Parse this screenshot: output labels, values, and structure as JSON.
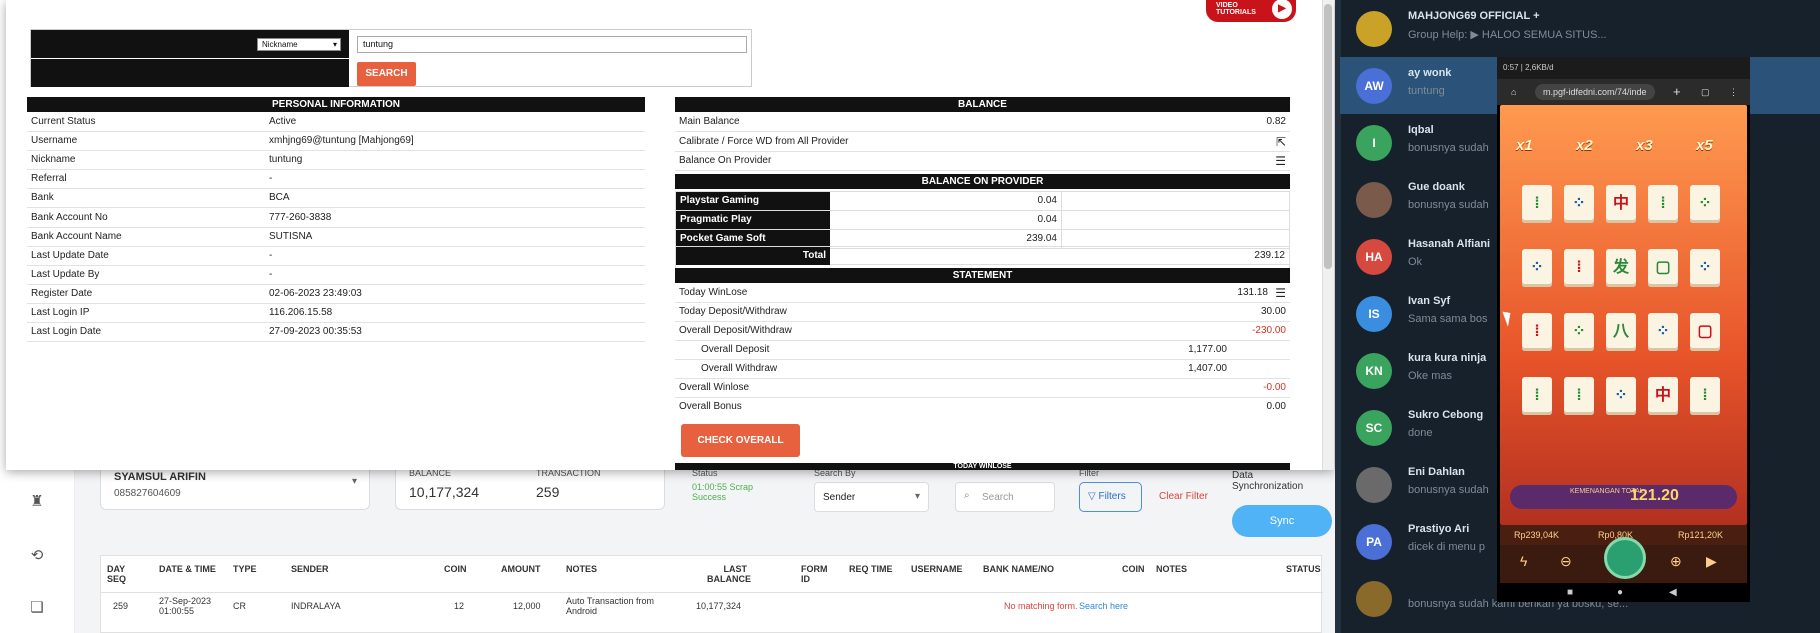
{
  "modal": {
    "search": {
      "select_value": "Nickname",
      "input_value": "tuntung",
      "button": "SEARCH"
    },
    "personal": {
      "title": "PERSONAL INFORMATION",
      "rows": [
        {
          "label": "Current Status",
          "value": "Active"
        },
        {
          "label": "Username",
          "value": "xmhjng69@tuntung  [Mahjong69]"
        },
        {
          "label": "Nickname",
          "value": "tuntung"
        },
        {
          "label": "Referral",
          "value": "-"
        },
        {
          "label": "Bank",
          "value": "BCA"
        },
        {
          "label": "Bank Account No",
          "value": "777-260-3838"
        },
        {
          "label": "Bank Account Name",
          "value": "SUTISNA"
        },
        {
          "label": "Last Update Date",
          "value": "-"
        },
        {
          "label": "Last Update By",
          "value": "-"
        },
        {
          "label": "Register Date",
          "value": "02-06-2023 23:49:03"
        },
        {
          "label": "Last Login IP",
          "value": "116.206.15.58"
        },
        {
          "label": "Last Login Date",
          "value": "27-09-2023 00:35:53"
        }
      ]
    },
    "balance": {
      "title": "BALANCE",
      "main_label": "Main Balance",
      "main_value": "0.82",
      "calibrate_label": "Calibrate / Force WD from All Provider",
      "provider_label": "Balance On Provider",
      "provider_title": "BALANCE ON PROVIDER",
      "providers": [
        {
          "name": "Playstar Gaming",
          "value": "0.04"
        },
        {
          "name": "Pragmatic Play",
          "value": "0.04"
        },
        {
          "name": "Pocket Game Soft",
          "value": "239.04"
        }
      ],
      "total_label": "Total",
      "total_value": "239.12"
    },
    "statement": {
      "title": "STATEMENT",
      "today_winlose_label": "Today WinLose",
      "today_winlose_value": "131.18",
      "today_dw_label": "Today Deposit/Withdraw",
      "today_dw_value": "30.00",
      "overall_dw_label": "Overall Deposit/Withdraw",
      "overall_dw_value": "-230.00",
      "overall_deposit_label": "Overall Deposit",
      "overall_deposit_value": "1,177.00",
      "overall_withdraw_label": "Overall Withdraw",
      "overall_withdraw_value": "1,407.00",
      "overall_winlose_label": "Overall Winlose",
      "overall_winlose_value": "-0.00",
      "overall_bonus_label": "Overall Bonus",
      "overall_bonus_value": "0.00",
      "check_button": "CHECK OVERALL",
      "next_section_partial": "TODAY WINLOSE"
    },
    "video_badge": {
      "line1": "VIDEO",
      "line2": "TUTORIALS"
    }
  },
  "background": {
    "customer_name": "SYAMSUL ARIFIN",
    "customer_phone": "085827604609",
    "balance_label": "BALANCE",
    "balance_value": "10,177,324",
    "transaction_label": "TRANSACTION",
    "transaction_value": "259",
    "status_label": "Status",
    "status_value": "01:00:55 Scrap Success",
    "search_by_label": "Search By",
    "search_by_value": "Sender",
    "search_placeholder": "Search",
    "filter_label": "Filter",
    "filters_button": "Filters",
    "clear_filter": "Clear Filter",
    "data_sync_label": "Data Synchronization",
    "sync_button": "Sync",
    "table": {
      "headers": [
        "DAY SEQ",
        "DATE & TIME",
        "TYPE",
        "SENDER",
        "COIN",
        "AMOUNT",
        "NOTES",
        "LAST BALANCE",
        "FORM ID",
        "REQ TIME",
        "USERNAME",
        "BANK NAME/NO",
        "COIN",
        "NOTES",
        "STATUS"
      ],
      "row": {
        "seq": "259",
        "datetime": "27-Sep-2023 01:00:55",
        "type": "CR",
        "sender": "INDRALAYA",
        "coin": "12",
        "amount": "12,000",
        "notes": "Auto Transaction from Android",
        "last_balance": "10,177,324",
        "no_match": "No matching form.",
        "search_here": "Search here"
      }
    }
  },
  "chat": {
    "items": [
      {
        "initials": "",
        "name": "MAHJONG69 OFFICIAL +",
        "msg": "Group Help: ▶ HALOO SEMUA SITUS...",
        "color": "#c9a227"
      },
      {
        "initials": "AW",
        "name": "ay wonk",
        "msg": "tuntung",
        "color": "#4a6fd6"
      },
      {
        "initials": "I",
        "name": "Iqbal",
        "msg": "bonusnya sudah",
        "color": "#3aa35d"
      },
      {
        "initials": "",
        "name": "Gue doank",
        "msg": "bonusnya sudah",
        "color": "#7a5a4a"
      },
      {
        "initials": "HA",
        "name": "Hasanah Alfiani",
        "msg": "Ok",
        "color": "#d6493f"
      },
      {
        "initials": "IS",
        "name": "Ivan Syf",
        "msg": "Sama sama bos",
        "color": "#3b8de0"
      },
      {
        "initials": "KN",
        "name": "kura kura ninja",
        "msg": "Oke mas",
        "color": "#3aa35d"
      },
      {
        "initials": "SC",
        "name": "Sukro Cebong",
        "msg": "done",
        "color": "#3aa35d"
      },
      {
        "initials": "",
        "name": "Eni Dahlan",
        "msg": "bonusnya sudah",
        "color": "#6a6a6a"
      },
      {
        "initials": "PA",
        "name": "Prastiyo Ari",
        "msg": "dicek di menu p",
        "color": "#4a6fd6"
      },
      {
        "initials": "",
        "name": "",
        "msg": "bonusnya sudah kami berikan ya bosku, se...",
        "color": "#8a6a2a"
      }
    ]
  },
  "phone": {
    "status": "0:57 | 2,6KB/d",
    "url": "m.pgf-idfedni.com/74/inde",
    "multipliers": [
      "x1",
      "x2",
      "x3",
      "x5"
    ],
    "win_label": "KEMENANGAN TOTAL",
    "win_value": "121.20",
    "balances": [
      "Rp239,04K",
      "Rp0,80K",
      "Rp121,20K"
    ]
  }
}
